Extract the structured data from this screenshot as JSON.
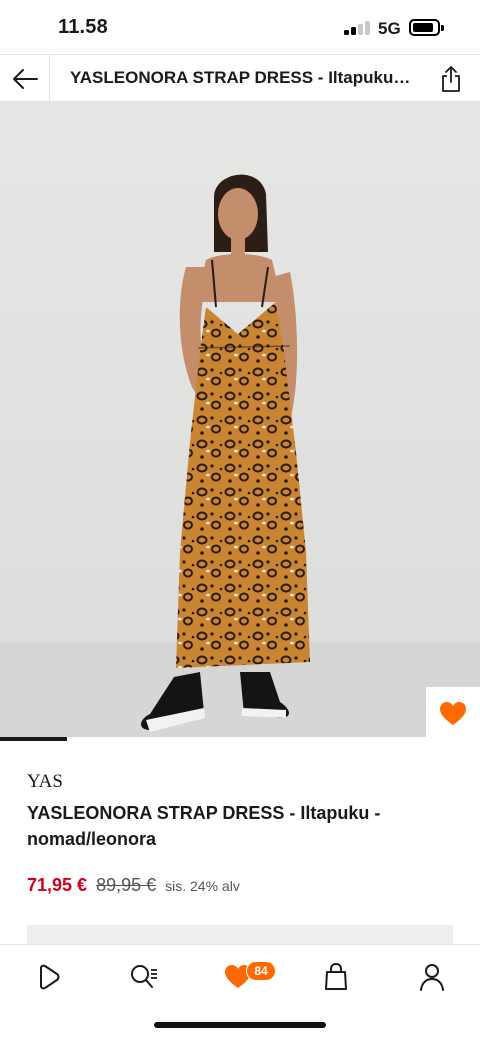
{
  "status_bar": {
    "time": "11.58",
    "network": "5G",
    "signal_bars": 2,
    "battery_level": 0.7
  },
  "header": {
    "title": "YASLEONORA STRAP DRESS  - Iltapuku - nomad/leonora",
    "back_icon": "arrow-left-icon",
    "share_icon": "share-icon"
  },
  "gallery": {
    "image_progress": 0.14,
    "favorite_icon": "heart-icon"
  },
  "product": {
    "brand": "YAS",
    "name": "YASLEONORA STRAP DRESS  - Iltapuku - nomad/leonora",
    "price_current": "71,95 €",
    "price_original": "89,95 €",
    "vat_note": "sis. 24% alv"
  },
  "tabbar": {
    "items": [
      {
        "name": "discover",
        "icon": "play-icon"
      },
      {
        "name": "search",
        "icon": "search-icon"
      },
      {
        "name": "wishlist",
        "icon": "heart-icon",
        "badge": "84"
      },
      {
        "name": "bag",
        "icon": "bag-icon"
      },
      {
        "name": "account",
        "icon": "user-icon"
      }
    ]
  },
  "colors": {
    "accent": "#ff6900",
    "price_red": "#d0021b"
  }
}
